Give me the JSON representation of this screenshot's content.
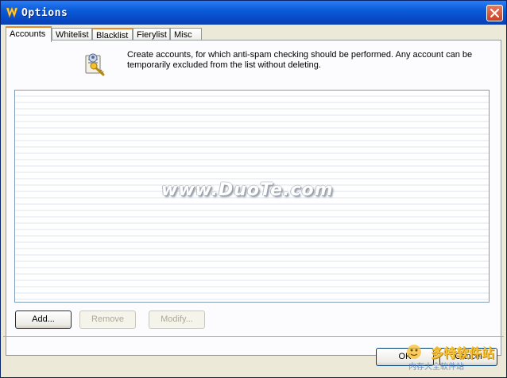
{
  "window": {
    "title": "Options"
  },
  "tabs": [
    {
      "label": "Accounts",
      "active": true
    },
    {
      "label": "Whitelist",
      "active": false
    },
    {
      "label": "Blacklist",
      "active": false
    },
    {
      "label": "Fierylist",
      "active": false
    },
    {
      "label": "Misc",
      "active": false
    }
  ],
  "accounts": {
    "description": "Create accounts, for which anti-spam checking should be performed. Any account can be temporarily excluded from the list without deleting.",
    "rows": [],
    "add_label": "Add...",
    "remove_label": "Remove",
    "modify_label": "Modify..."
  },
  "footer": {
    "ok_label": "OK",
    "cancel_label": "Cancel"
  },
  "watermark": {
    "text": "www.DuoTe.com"
  },
  "logo": {
    "text": "多特软件站",
    "sub": "内存大全软件站"
  },
  "colors": {
    "title_bar": "#0b5bd8",
    "tab_hot": "#e68b2c",
    "list_border": "#7f9db9"
  }
}
